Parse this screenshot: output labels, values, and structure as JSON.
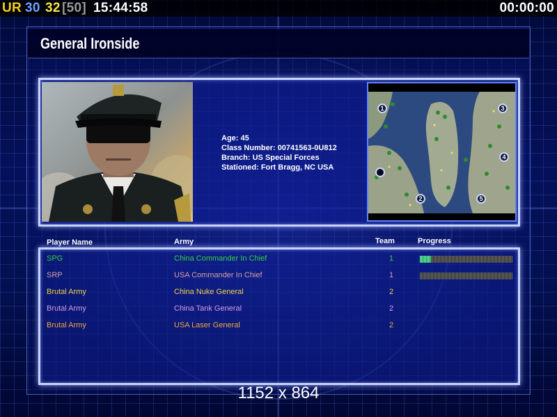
{
  "status": {
    "ur_label": "UR",
    "num1": "30",
    "num2": "32",
    "num3": "[50]",
    "clock": "15:44:58",
    "timer": "00:00:00"
  },
  "title": "General Ironside",
  "bio": {
    "age": "Age: 45",
    "class_number": "Class Number: 00741563-0U812",
    "branch": "Branch: US Special Forces",
    "stationed": "Stationed: Fort Bragg, NC USA"
  },
  "map": {
    "start_positions": [
      "1",
      "2",
      "3",
      "4",
      "5",
      ""
    ]
  },
  "columns": {
    "player": "Player Name",
    "army": "Army",
    "team": "Team",
    "progress": "Progress"
  },
  "players": [
    {
      "name": "SPG",
      "army": "China Commander In Chief",
      "team": "1",
      "color": "#35d13a",
      "progress": 0.12
    },
    {
      "name": "SRP",
      "army": "USA Commander In Chief",
      "team": "1",
      "color": "#d7a0a6",
      "progress": 0
    },
    {
      "name": "Brutal Army",
      "army": "China Nuke General",
      "team": "2",
      "color": "#f2d240",
      "progress": null
    },
    {
      "name": "Brutal Army",
      "army": "China Tank General",
      "team": "2",
      "color": "#d79be6",
      "progress": null
    },
    {
      "name": "Brutal Army",
      "army": "USA Laser General",
      "team": "2",
      "color": "#f0a838",
      "progress": null
    }
  ],
  "resolution": "1152 x 864"
}
